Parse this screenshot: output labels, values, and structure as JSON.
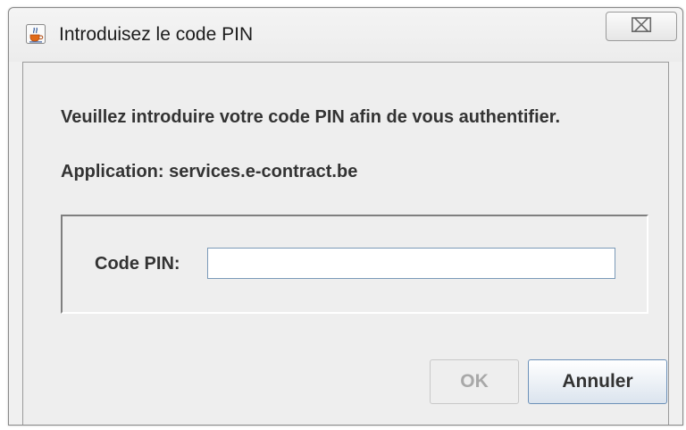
{
  "window": {
    "title": "Introduisez le code PIN",
    "icon": "java-cup-icon",
    "close_glyph": "⌧"
  },
  "dialog": {
    "message": "Veuillez introduire votre code PIN afin de vous authentifier.",
    "application_line": "Application: services.e-contract.be"
  },
  "pin": {
    "label": "Code PIN:",
    "value": "",
    "placeholder": ""
  },
  "buttons": {
    "ok_label": "OK",
    "ok_enabled": false,
    "cancel_label": "Annuler"
  },
  "colors": {
    "dialog_background": "#eeeeee",
    "text": "#333333",
    "disabled_text": "#a8a8a8"
  }
}
